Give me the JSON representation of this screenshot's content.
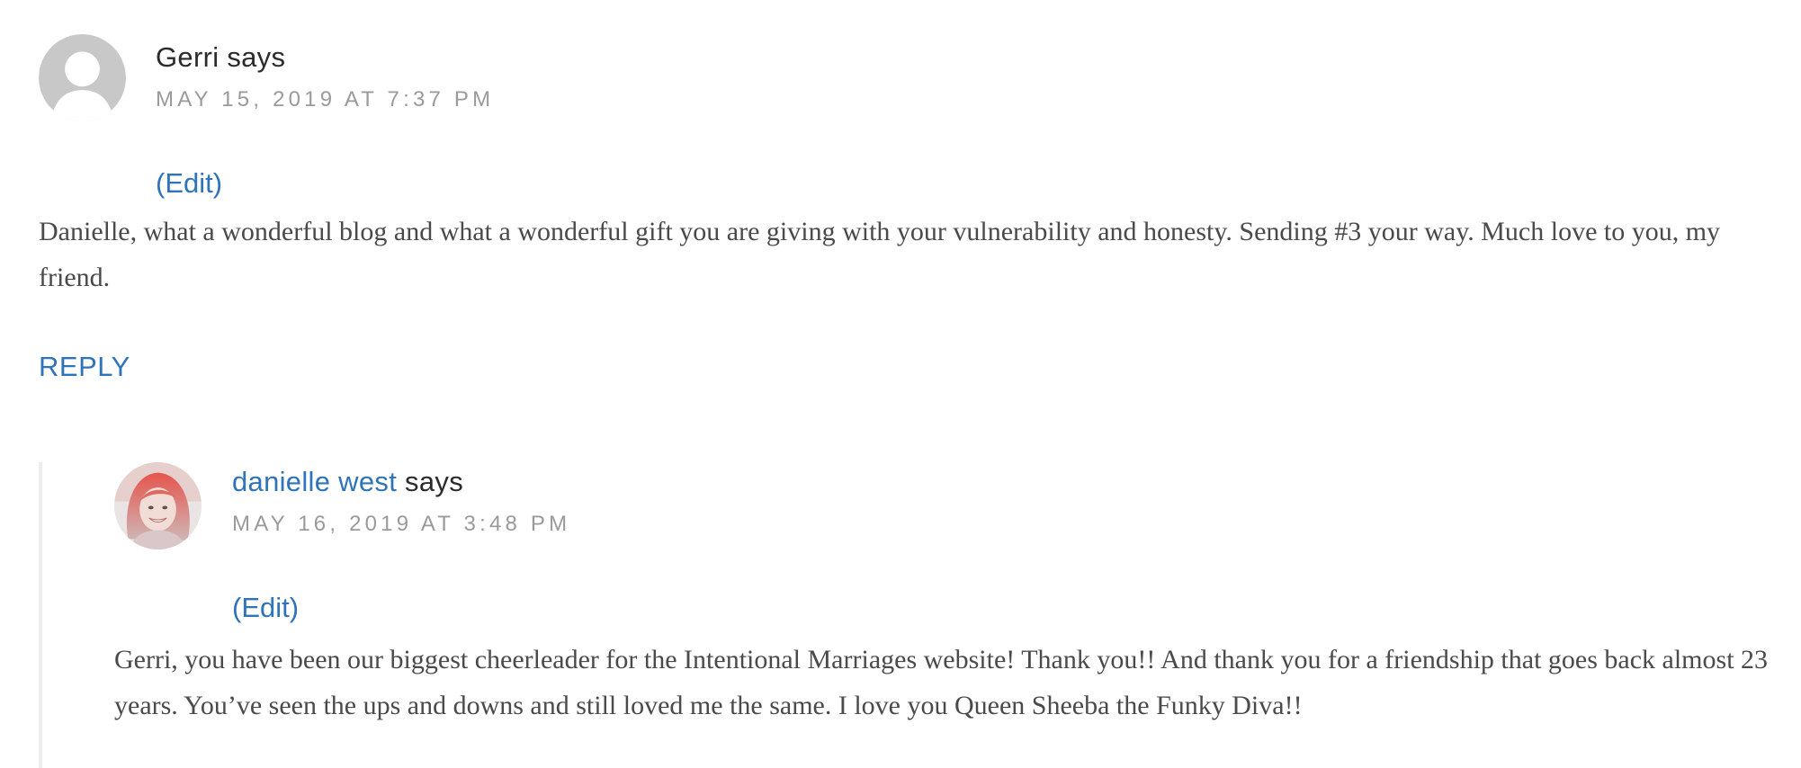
{
  "comments": [
    {
      "author": "Gerri",
      "says": "says",
      "date": "MAY 15, 2019 AT 7:37 PM",
      "edit_label": "(Edit)",
      "body": "Danielle, what a wonderful blog and what a wonderful gift you are giving with your vulnerability and honesty. Sending #3 your way. Much love to you, my friend.",
      "reply_label": "REPLY",
      "avatar_icon": "default-avatar-icon"
    },
    {
      "author": "danielle west",
      "says": "says",
      "date": "MAY 16, 2019 AT 3:48 PM",
      "edit_label": "(Edit)",
      "body": "Gerri, you have been our biggest cheerleader for the Intentional Marriages website! Thank you!! And thank you for a friendship that goes back almost 23 years. You’ve seen the ups and downs and still loved me the same. I love you Queen Sheeba the Funky Diva!!",
      "avatar_icon": "user-photo-avatar"
    }
  ],
  "colors": {
    "link": "#2f73b8",
    "body_text": "#4a4a4a",
    "meta_text": "#9a9a9a",
    "author_text": "#2b2b2b",
    "thread_border": "#eeeeee"
  }
}
